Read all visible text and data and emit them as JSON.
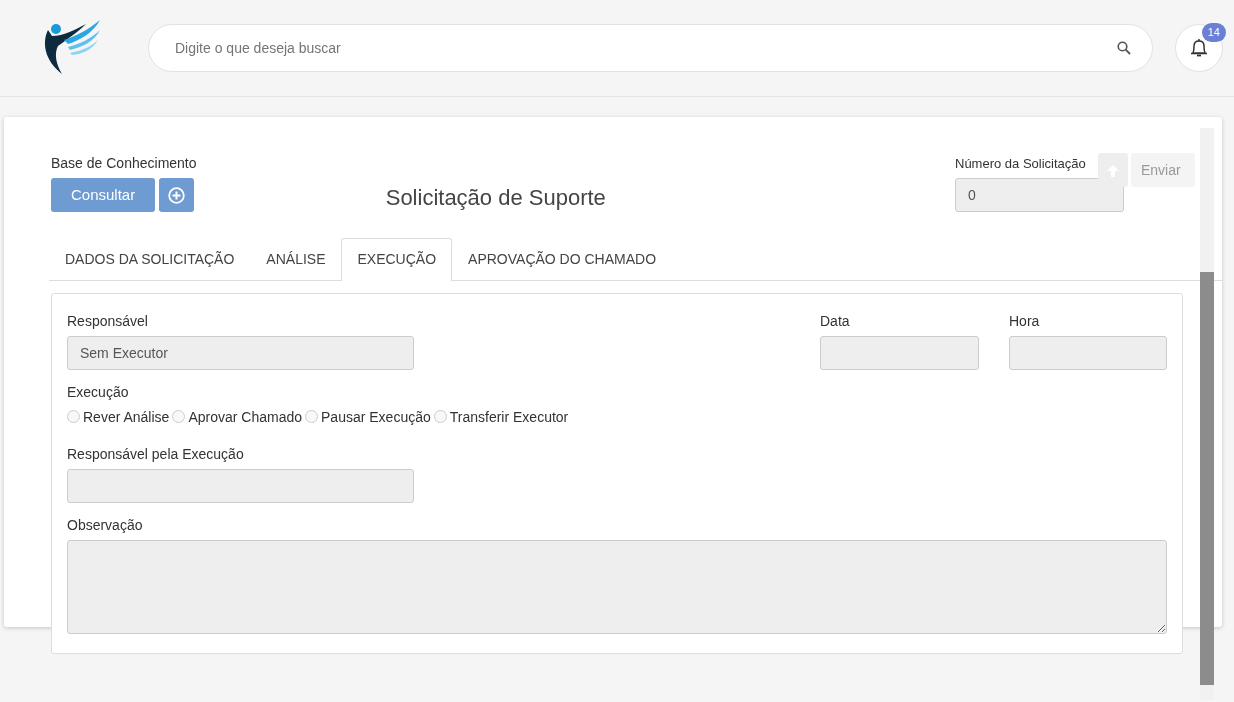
{
  "header": {
    "search": {
      "placeholder": "Digite o que deseja buscar"
    },
    "notifications": {
      "count": "14"
    }
  },
  "toolbar": {
    "send_button": "Enviar"
  },
  "form": {
    "knowledge_base": {
      "label": "Base de Conhecimento",
      "button": "Consultar"
    },
    "title": "Solicitação de Suporte",
    "request_number": {
      "label": "Número da Solicitação",
      "value": "0"
    },
    "tabs": [
      {
        "label": "DADOS DA SOLICITAÇÃO",
        "selected": false
      },
      {
        "label": "ANÁLISE",
        "selected": false
      },
      {
        "label": "EXECUÇÃO",
        "selected": true
      },
      {
        "label": "APROVAÇÃO DO CHAMADO",
        "selected": false
      }
    ],
    "responsible": {
      "label": "Responsável",
      "value": "Sem Executor"
    },
    "date": {
      "label": "Data"
    },
    "time": {
      "label": "Hora"
    },
    "execution": {
      "label": "Execução",
      "options": [
        {
          "label": "Rever Análise",
          "selected": false
        },
        {
          "label": "Aprovar Chamado",
          "selected": false
        },
        {
          "label": "Pausar Execução",
          "selected": false
        },
        {
          "label": "Transferir Executor",
          "selected": false
        }
      ]
    },
    "executor": {
      "label": "Responsável pela Execução"
    },
    "notes": {
      "label": "Observação"
    }
  }
}
